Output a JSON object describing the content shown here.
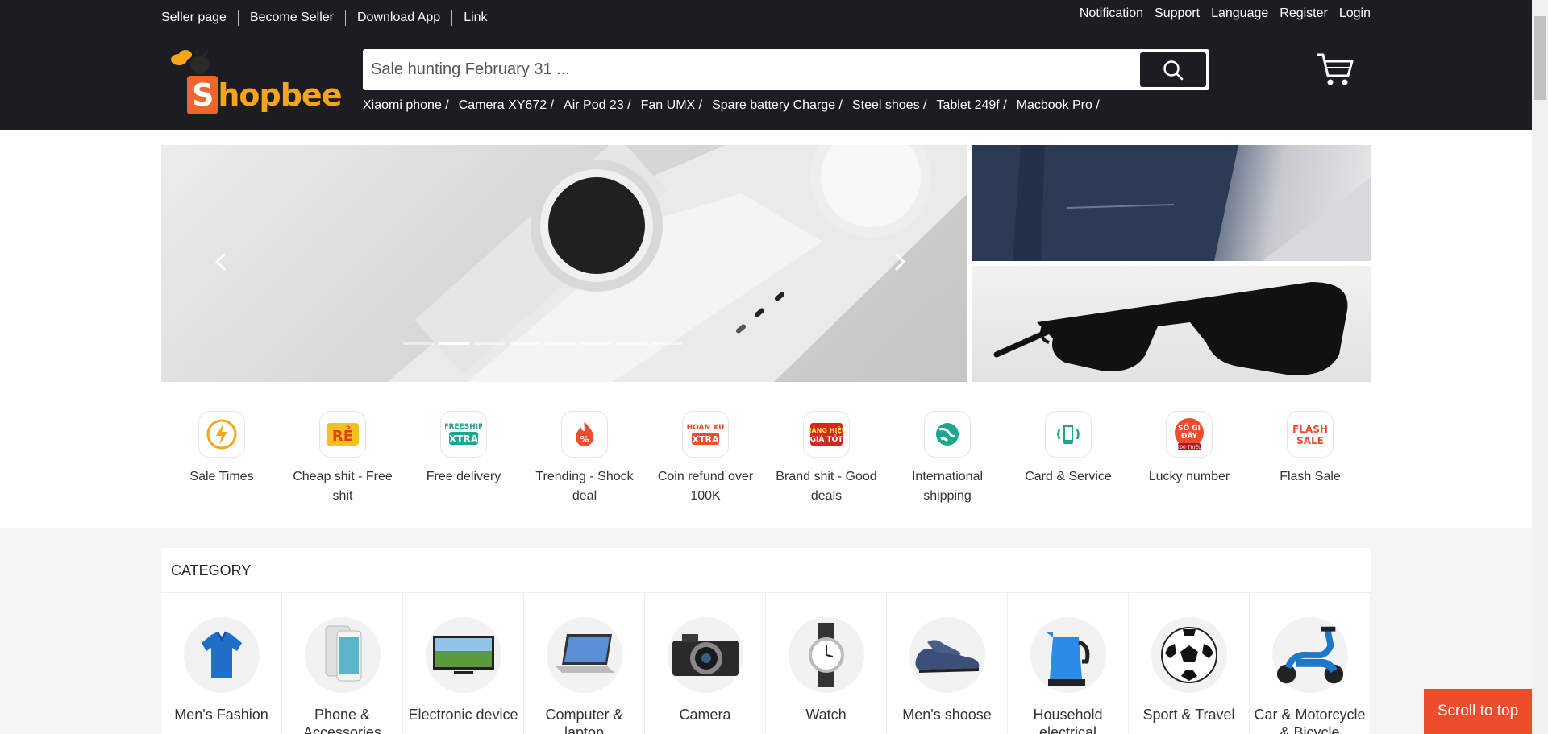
{
  "topbar": {
    "left_links": [
      "Seller page",
      "Become Seller",
      "Download App",
      "Link"
    ],
    "right_links": [
      "Notification",
      "Support",
      "Language",
      "Register",
      "Login"
    ]
  },
  "logo": {
    "text_first": "S",
    "text_rest": "hopbee"
  },
  "search": {
    "placeholder": "Sale hunting February 31 ...",
    "value": ""
  },
  "suggestions": [
    "Xiaomi phone /",
    "Camera XY672 /",
    "Air Pod 23 /",
    "Fan UMX /",
    "Spare battery Charge /",
    "Steel shoes /",
    "Tablet 249f /",
    "Macbook Pro /"
  ],
  "carousel": {
    "slides": 8,
    "active_index": 1
  },
  "quick_links": [
    {
      "label": "Sale Times",
      "icon": "lightning-icon",
      "color": "#f6a51a"
    },
    {
      "label": "Cheap shit - Free shit",
      "icon": "re-badge-icon",
      "color": "#f6a51a"
    },
    {
      "label": "Free delivery",
      "icon": "freeship-icon",
      "color": "#1aa68f"
    },
    {
      "label": "Trending - Shock deal",
      "icon": "fire-percent-icon",
      "color": "#ee4d2d"
    },
    {
      "label": "Coin refund over 100K",
      "icon": "coin-refund-icon",
      "color": "#ee4d2d"
    },
    {
      "label": "Brand shit - Good deals",
      "icon": "brand-deal-icon",
      "color": "#d7261e"
    },
    {
      "label": "International shipping",
      "icon": "globe-icon",
      "color": "#1aa68f"
    },
    {
      "label": "Card & Service",
      "icon": "phone-signal-icon",
      "color": "#1aa68f"
    },
    {
      "label": "Lucky number",
      "icon": "lucky-icon",
      "color": "#ee4d2d"
    },
    {
      "label": "Flash Sale",
      "icon": "flash-sale-icon",
      "color": "#ee4d2d"
    }
  ],
  "category": {
    "title": "CATEGORY",
    "items": [
      {
        "label": "Men's Fashion",
        "icon": "polo-shirt-icon"
      },
      {
        "label": "Phone & Accessories",
        "icon": "phone-icon"
      },
      {
        "label": "Electronic device",
        "icon": "tv-icon"
      },
      {
        "label": "Computer & laptop",
        "icon": "laptop-icon"
      },
      {
        "label": "Camera",
        "icon": "camera-icon"
      },
      {
        "label": "Watch",
        "icon": "watch-icon"
      },
      {
        "label": "Men's shoose",
        "icon": "shoe-icon"
      },
      {
        "label": "Household electrical",
        "icon": "kettle-icon"
      },
      {
        "label": "Sport & Travel",
        "icon": "soccer-ball-icon"
      },
      {
        "label": "Car & Motorcycle & Bicycle",
        "icon": "scooter-icon"
      }
    ]
  },
  "scroll_top": {
    "label": "Scroll to top"
  },
  "colors": {
    "header_bg": "#1c1c22",
    "accent": "#ee4d2d",
    "logo_orange": "#f6a51a"
  }
}
